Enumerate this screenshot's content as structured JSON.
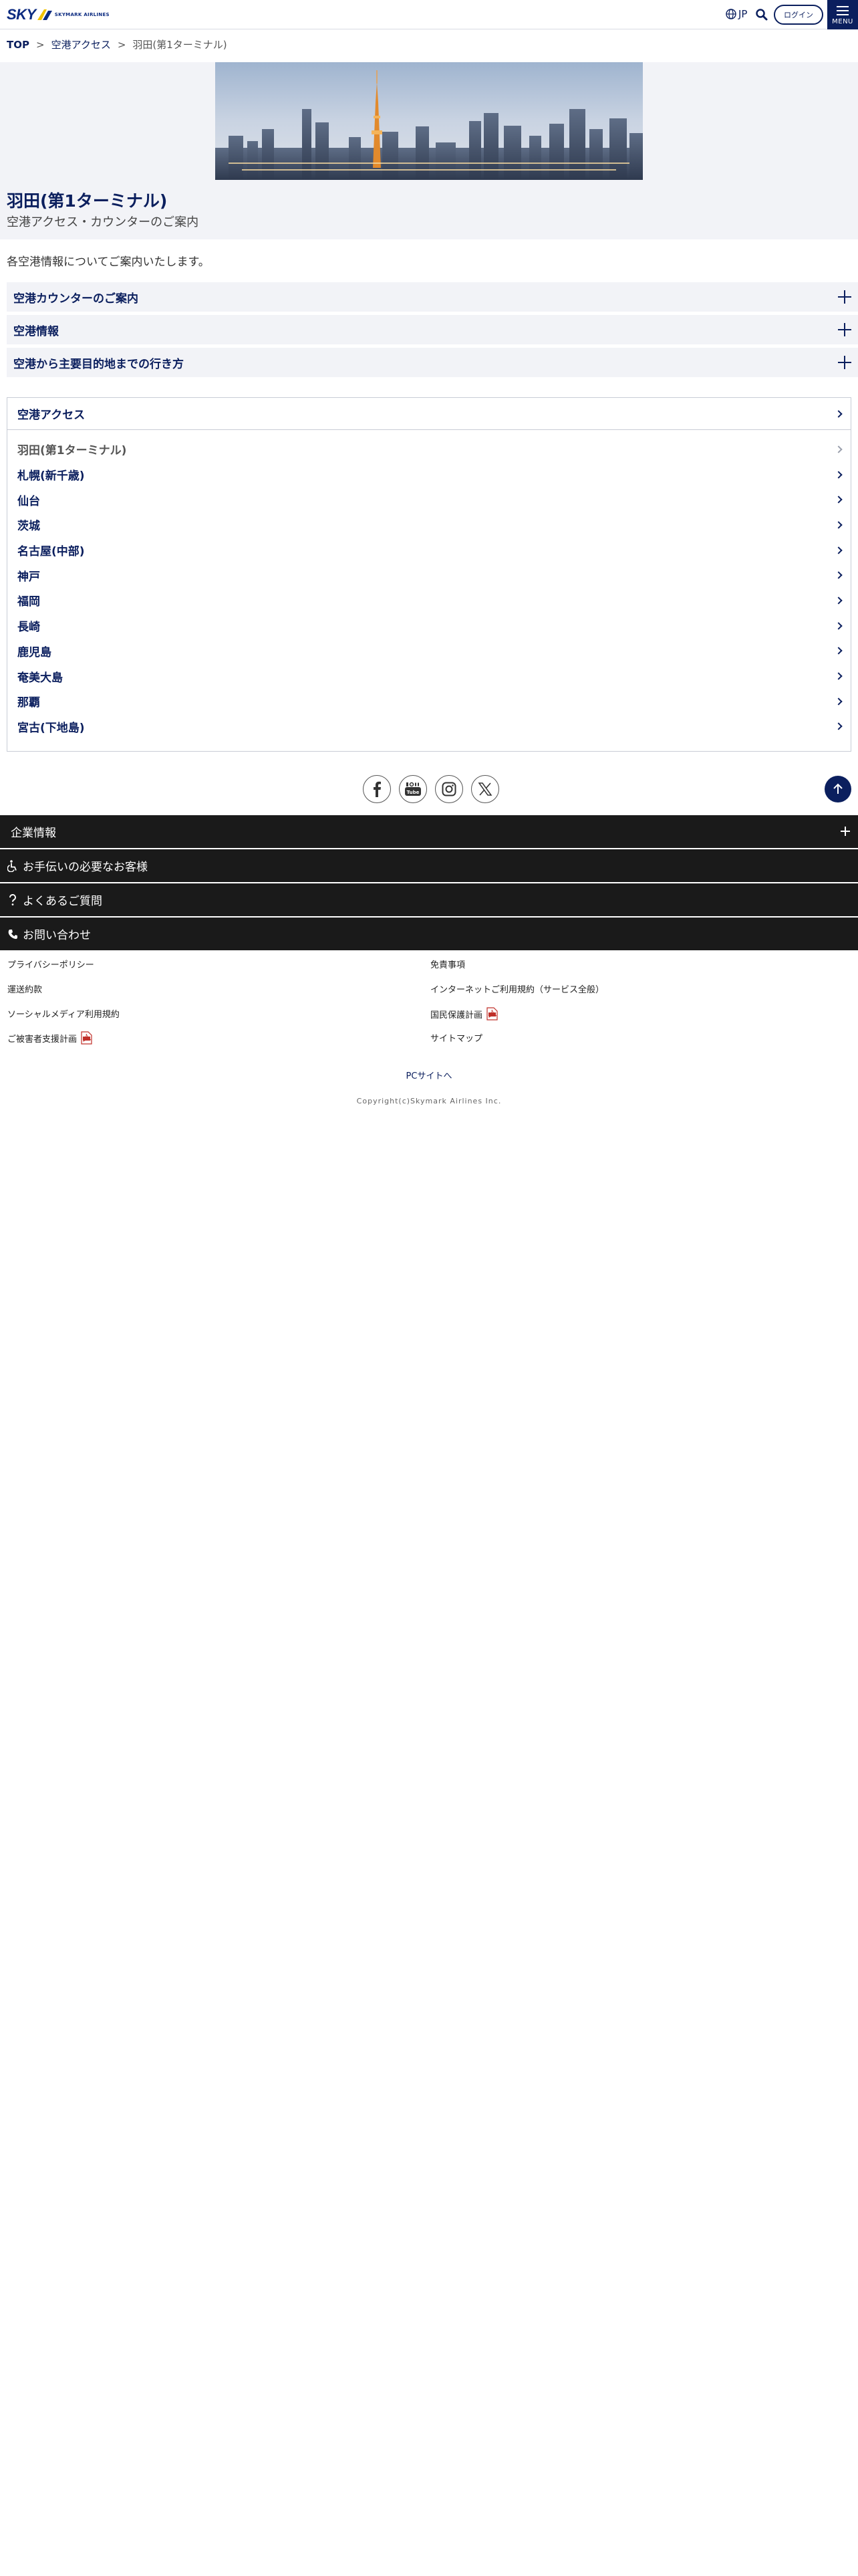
{
  "header": {
    "logo_text": "SKY",
    "logo_sub": "SKYMARK AIRLINES",
    "lang_label": "JP",
    "login_label": "ログイン",
    "menu_label": "MENU"
  },
  "breadcrumb": {
    "items": [
      "TOP",
      "空港アクセス",
      "羽田(第1ターミナル)"
    ],
    "separator": ">"
  },
  "hero": {
    "title": "羽田(第1ターミナル)",
    "subtitle": "空港アクセス・カウンターのご案内"
  },
  "intro": "各空港情報についてご案内いたします。",
  "accordions": [
    {
      "label": "空港カウンターのご案内"
    },
    {
      "label": "空港情報"
    },
    {
      "label": "空港から主要目的地までの行き方"
    }
  ],
  "access": {
    "heading": "空港アクセス",
    "items": [
      {
        "label": "羽田(第1ターミナル)",
        "current": true
      },
      {
        "label": "札幌(新千歳)"
      },
      {
        "label": "仙台"
      },
      {
        "label": "茨城"
      },
      {
        "label": "名古屋(中部)"
      },
      {
        "label": "神戸"
      },
      {
        "label": "福岡"
      },
      {
        "label": "長崎"
      },
      {
        "label": "鹿児島"
      },
      {
        "label": "奄美大島"
      },
      {
        "label": "那覇"
      },
      {
        "label": "宮古(下地島)"
      }
    ]
  },
  "social": [
    "facebook-icon",
    "youtube-icon",
    "instagram-icon",
    "x-icon"
  ],
  "footer": {
    "bars": [
      {
        "label": "企業情報"
      },
      {
        "label": "お手伝いの必要なお客様"
      },
      {
        "label": "よくあるご質問"
      },
      {
        "label": "お問い合わせ"
      }
    ],
    "links_left": [
      "プライバシーポリシー",
      "運送約款",
      "ソーシャルメディア利用規約",
      "ご被害者支援計画"
    ],
    "links_right": [
      "免責事項",
      "インターネットご利用規約（サービス全般）",
      "国民保護計画",
      "サイトマップ"
    ],
    "pc_site": "PCサイトへ",
    "copyright": "Copyright(c)Skymark Airlines Inc."
  },
  "colors": {
    "navy": "#0b1f5e",
    "panel_bg": "#f2f3f7",
    "footer_dark": "#1a1a1a"
  }
}
